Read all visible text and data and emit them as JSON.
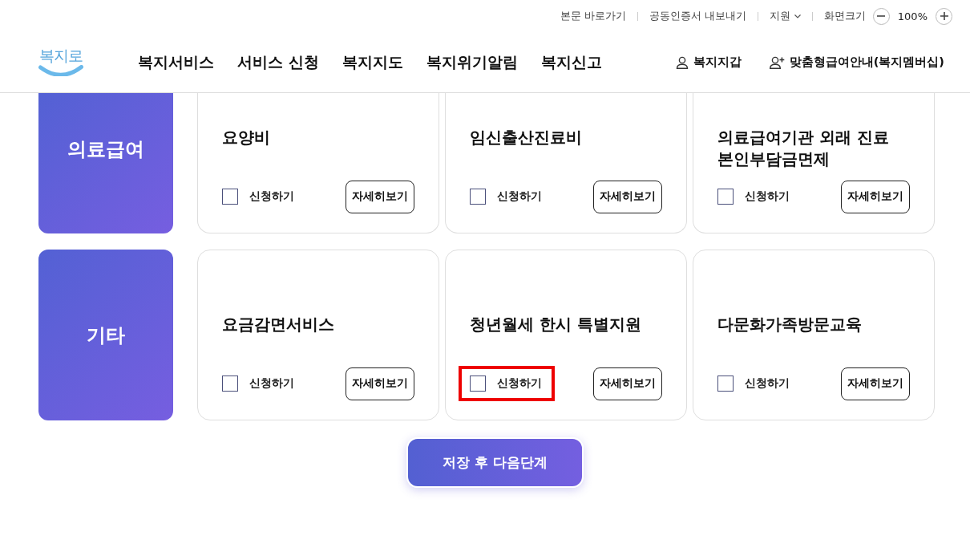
{
  "utility_bar": {
    "links": [
      {
        "label": "본문 바로가기",
        "kind": "link"
      },
      {
        "label": "공동인증서 내보내기",
        "kind": "link"
      },
      {
        "label": "지원",
        "kind": "dropdown"
      }
    ],
    "zoom": {
      "label": "화면크기",
      "value": "100%"
    }
  },
  "header": {
    "logo": "복지로",
    "nav": [
      "복지서비스",
      "서비스 신청",
      "복지지도",
      "복지위기알림",
      "복지신고"
    ],
    "actions": [
      "복지지갑",
      "맞춤형급여안내(복지멤버십)"
    ]
  },
  "sections": [
    {
      "category": "의료급여",
      "services": [
        {
          "title": "요양비",
          "apply_label": "신청하기",
          "checked": false,
          "highlighted": false,
          "details_button": "자세히보기"
        },
        {
          "title": "임신출산진료비",
          "apply_label": "신청하기",
          "checked": false,
          "highlighted": false,
          "details_button": "자세히보기"
        },
        {
          "title": "의료급여기관 외래 진료 본인부담금면제",
          "apply_label": "신청하기",
          "checked": false,
          "highlighted": false,
          "details_button": "자세히보기"
        }
      ]
    },
    {
      "category": "기타",
      "services": [
        {
          "title": "요금감면서비스",
          "apply_label": "신청하기",
          "checked": false,
          "highlighted": false,
          "details_button": "자세히보기"
        },
        {
          "title": "청년월세 한시 특별지원",
          "apply_label": "신청하기",
          "checked": false,
          "highlighted": true,
          "details_button": "자세히보기"
        },
        {
          "title": "다문화가족방문교육",
          "apply_label": "신청하기",
          "checked": false,
          "highlighted": false,
          "details_button": "자세히보기"
        }
      ]
    }
  ],
  "next_button": "저장 후 다음단계"
}
